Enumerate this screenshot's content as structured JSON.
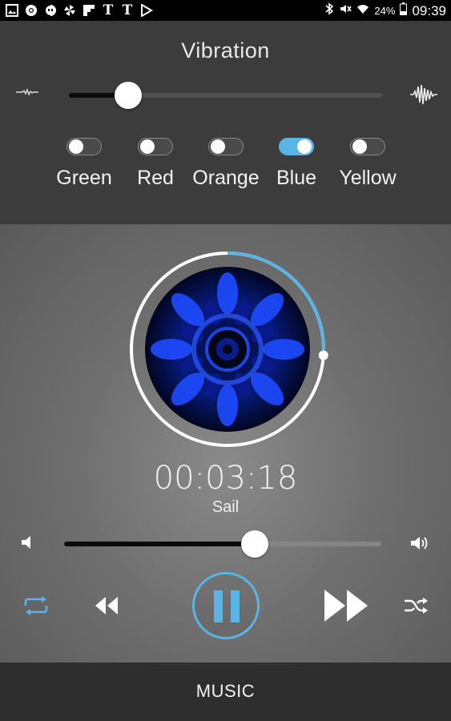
{
  "status_bar": {
    "left_icons": [
      "gallery-icon",
      "chrome-icon",
      "hangouts-icon",
      "pinwheel-icon",
      "flipboard-icon",
      "nyt-icon",
      "nyt-icon",
      "play-store-icon"
    ],
    "bluetooth_icon": "bluetooth-icon",
    "mute_icon": "mute-icon",
    "wifi_icon": "wifi-icon",
    "battery_percent": "24%",
    "time": "09:39"
  },
  "vibration": {
    "title": "Vibration",
    "level": 0.19
  },
  "colors": {
    "accent": "#5ab4e6",
    "items": [
      {
        "label": "Green",
        "on": false
      },
      {
        "label": "Red",
        "on": false
      },
      {
        "label": "Orange",
        "on": false
      },
      {
        "label": "Blue",
        "on": true
      },
      {
        "label": "Yellow",
        "on": false
      }
    ]
  },
  "player": {
    "elapsed": "00:03:18",
    "track": "Sail",
    "progress": 0.26,
    "volume": 0.6,
    "controls": {
      "repeat": "repeat-icon",
      "rewind": "rewind-icon",
      "pause": "pause-icon",
      "fast_forward": "fast-forward-icon",
      "shuffle": "shuffle-icon"
    }
  },
  "bottom_bar": {
    "label": "MUSIC"
  }
}
